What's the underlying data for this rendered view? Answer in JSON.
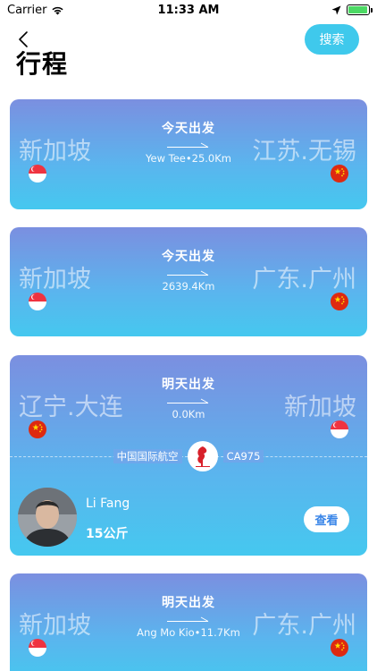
{
  "status_bar": {
    "carrier": "Carrier",
    "time": "11:33 AM",
    "battery_level": 0.95
  },
  "header": {
    "title": "行程",
    "search_label": "搜索"
  },
  "colors": {
    "accent": "#3fc9ec",
    "card_top": "#7b8fe0",
    "card_bottom": "#45c8ef",
    "battery": "#4cd964"
  },
  "trips": [
    {
      "from_city": "新加坡",
      "to_city": "江苏.无锡",
      "depart": "今天出发",
      "distance": "Yew Tee•25.0Km",
      "from_flag": "singapore-flag-icon",
      "to_flag": "china-flag-icon"
    },
    {
      "from_city": "新加坡",
      "to_city": "广东.广州",
      "depart": "今天出发",
      "distance": "2639.4Km",
      "from_flag": "singapore-flag-icon",
      "to_flag": "china-flag-icon"
    },
    {
      "from_city": "辽宁.大连",
      "to_city": "新加坡",
      "depart": "明天出发",
      "distance": "0.0Km",
      "from_flag": "china-flag-icon",
      "to_flag": "singapore-flag-icon",
      "airline": {
        "name": "中国国际航空",
        "flight": "CA975",
        "logo": "air-china-logo-icon"
      },
      "traveler": {
        "name": "Li Fang",
        "weight": "15公斤",
        "view_label": "查看"
      }
    },
    {
      "from_city": "新加坡",
      "to_city": "广东.广州",
      "depart": "明天出发",
      "distance": "Ang Mo Kio•11.7Km",
      "from_flag": "singapore-flag-icon",
      "to_flag": "china-flag-icon"
    }
  ]
}
